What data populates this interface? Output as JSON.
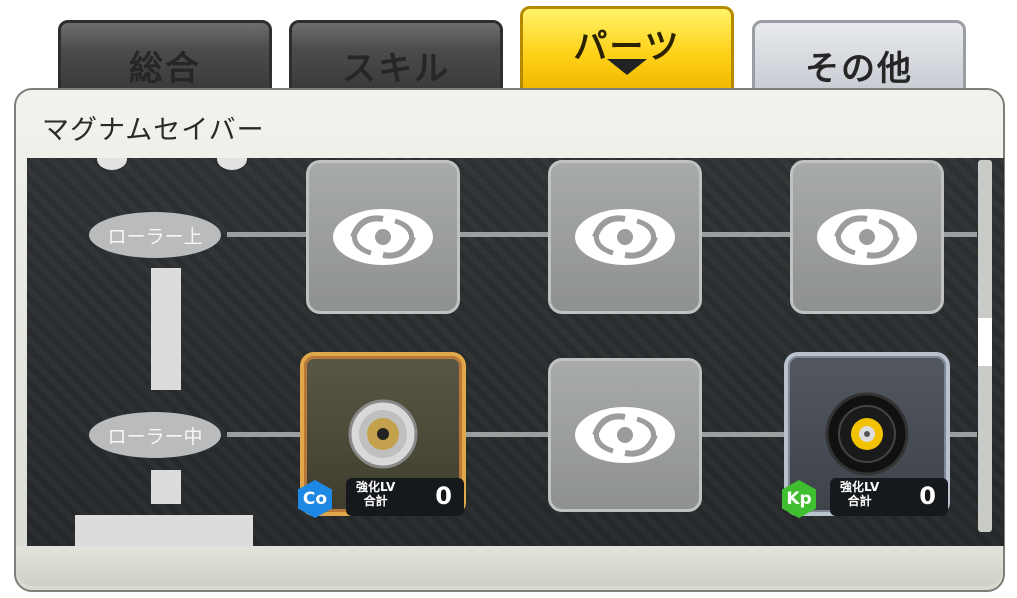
{
  "tabs": [
    {
      "label": "総合",
      "active": false
    },
    {
      "label": "スキル",
      "active": false
    },
    {
      "label": "パーツ",
      "active": true
    },
    {
      "label": "その他",
      "active": false
    }
  ],
  "panel": {
    "title": "マグナムセイバー"
  },
  "tree": {
    "rows": [
      {
        "node_label": "ローラー上",
        "slots": [
          {
            "state": "empty",
            "icon": "empty-slot-swirl-icon"
          },
          {
            "state": "empty",
            "icon": "empty-slot-swirl-icon"
          },
          {
            "state": "empty",
            "icon": "empty-slot-swirl-icon"
          }
        ]
      },
      {
        "node_label": "ローラー中",
        "slots": [
          {
            "state": "equipped",
            "frame": "gold",
            "icon": "roller-part-icon",
            "badge": "Co",
            "badge_color": "#1e88e5",
            "lv_label_1": "強化LV",
            "lv_label_2": "合計",
            "lv_value": "0"
          },
          {
            "state": "empty",
            "icon": "empty-slot-swirl-icon"
          },
          {
            "state": "equipped",
            "frame": "silver",
            "icon": "roller-part-icon",
            "badge": "Kp",
            "badge_color": "#3fbf2f",
            "lv_label_1": "強化LV",
            "lv_label_2": "合計",
            "lv_value": "0"
          }
        ]
      }
    ]
  },
  "colors": {
    "active_tab": "#ffd21a",
    "panel_bg": "#262a2c"
  }
}
